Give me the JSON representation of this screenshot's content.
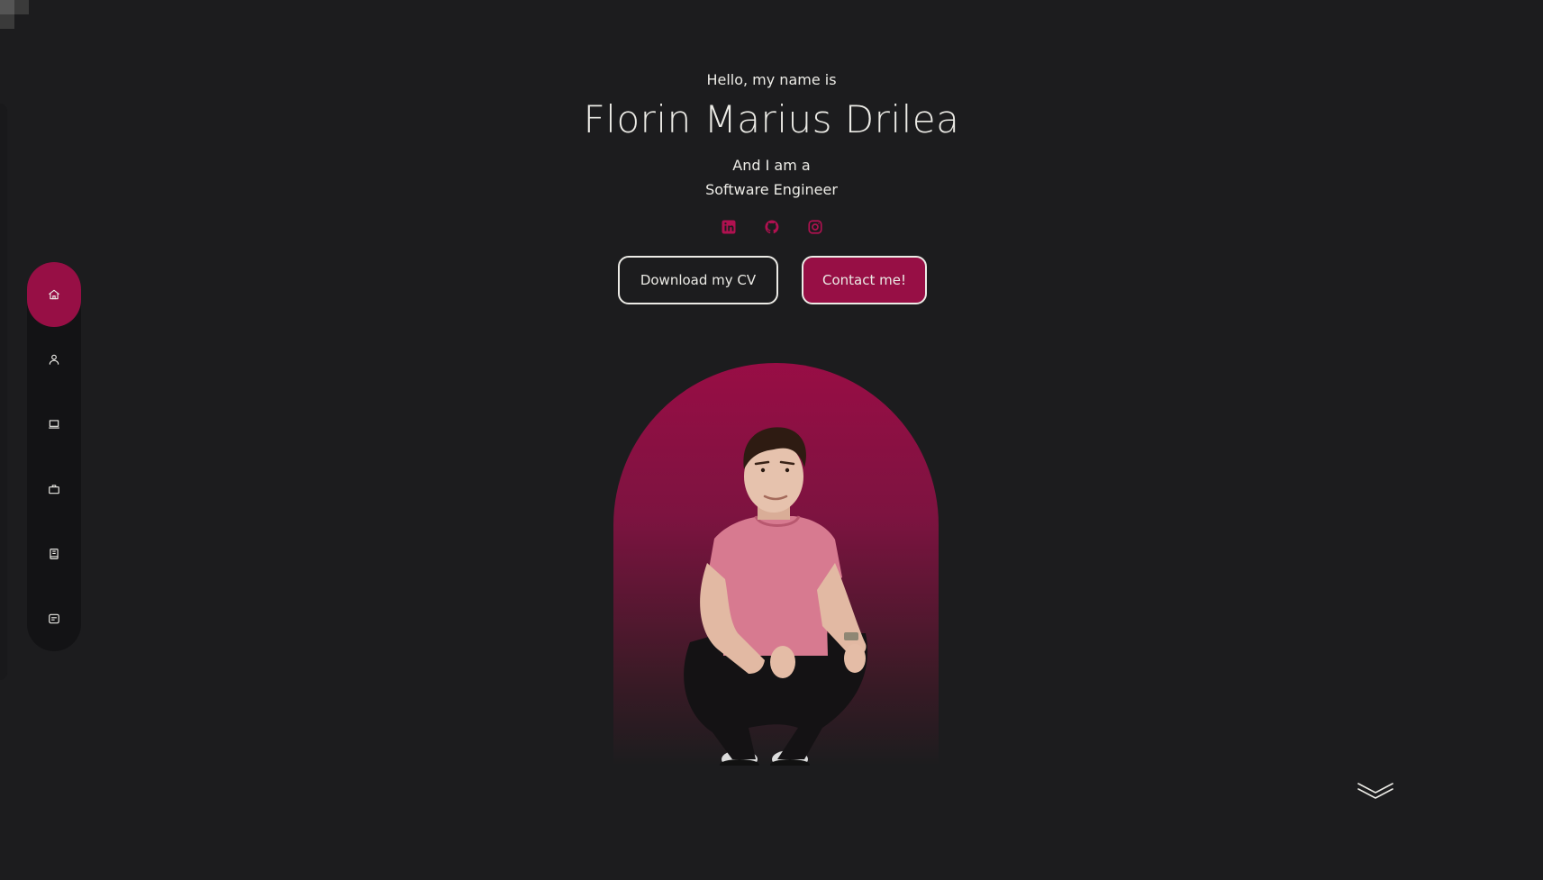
{
  "hero": {
    "greeting": "Hello, my name is",
    "name": "Florin Marius Drilea",
    "role_intro": "And I am a",
    "role": "Software Engineer"
  },
  "socials": [
    {
      "icon": "linkedin-icon"
    },
    {
      "icon": "github-icon"
    },
    {
      "icon": "instagram-icon"
    }
  ],
  "buttons": {
    "download_cv": "Download my CV",
    "contact": "Contact me!"
  },
  "sidebar": {
    "items": [
      {
        "icon": "home-icon",
        "active": true
      },
      {
        "icon": "user-icon",
        "active": false
      },
      {
        "icon": "laptop-icon",
        "active": false
      },
      {
        "icon": "briefcase-icon",
        "active": false
      },
      {
        "icon": "book-icon",
        "active": false
      },
      {
        "icon": "message-icon",
        "active": false
      }
    ]
  },
  "colors": {
    "background": "#1c1c1e",
    "accent": "#970f45",
    "text": "#ecebe6",
    "sidebar": "#131315"
  },
  "scroll_indicator": {
    "icon": "chevrons-down-icon"
  }
}
